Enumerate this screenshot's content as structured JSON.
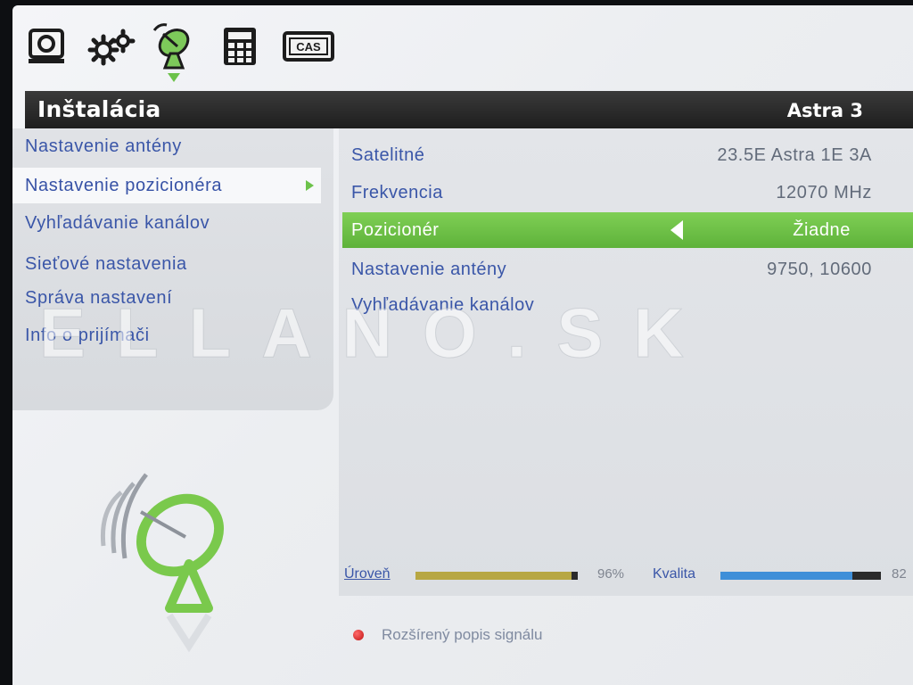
{
  "topbar": {
    "icons": [
      {
        "name": "tv-icon"
      },
      {
        "name": "settings-gears-icon"
      },
      {
        "name": "satellite-dish-icon",
        "active": true
      },
      {
        "name": "calculator-icon"
      },
      {
        "name": "cas-icon",
        "label": "CAS"
      }
    ]
  },
  "header": {
    "title": "Inštalácia",
    "satellite": "Astra 3"
  },
  "menu": {
    "items": [
      {
        "label": "Nastavenie antény"
      },
      {
        "label": "Nastavenie pozicionéra",
        "selected": true
      },
      {
        "label": "Vyhľadávanie kanálov"
      },
      {
        "label": "Sieťové nastavenia"
      },
      {
        "label": "Správa nastavení"
      },
      {
        "label": "Info o prijímači"
      }
    ]
  },
  "settings": {
    "rows": [
      {
        "label": "Satelitné",
        "value": "23.5E Astra 1E 3A"
      },
      {
        "label": "Frekvencia",
        "value": "12070 MHz"
      },
      {
        "label": "Pozicionér",
        "value": "Žiadne",
        "highlighted": true
      },
      {
        "label": "Nastavenie antény",
        "value": "9750, 10600"
      },
      {
        "label": "Vyhľadávanie kanálov",
        "value": ""
      }
    ]
  },
  "signal": {
    "level_label": "Úroveň",
    "level_percent": 96,
    "level_text": "96%",
    "quality_label": "Kvalita",
    "quality_percent": 82,
    "quality_text": "82"
  },
  "footer": {
    "hint": "Rozšírený popis signálu",
    "hint_color": "#d11a1a"
  },
  "watermark": {
    "text": "ELLANO.SK"
  },
  "colors": {
    "accent": "#6cc24a",
    "text": "#3a56a8",
    "value": "#626b7a",
    "level_bar": "#b7a743",
    "quality_bar": "#3f8fd8"
  }
}
